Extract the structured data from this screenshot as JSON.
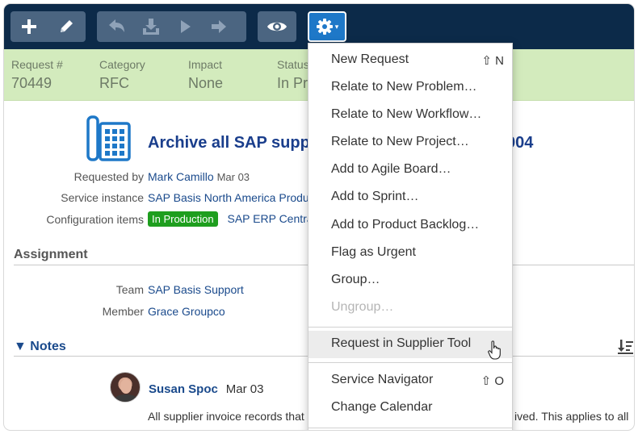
{
  "toolbar": {
    "buttons": [
      {
        "icon": "plus-icon",
        "label": "+"
      },
      {
        "icon": "pencil-icon"
      },
      {
        "icon": "undo-arrow-icon"
      },
      {
        "icon": "download-tray-icon"
      },
      {
        "icon": "play-icon"
      },
      {
        "icon": "right-arrow-icon"
      },
      {
        "icon": "eye-icon"
      },
      {
        "icon": "gear-icon"
      }
    ],
    "gear_caret": "▾"
  },
  "info": {
    "request_label": "Request #",
    "request_value": "70449",
    "category_label": "Category",
    "category_value": "RFC",
    "impact_label": "Impact",
    "impact_value": "None",
    "status_label": "Status",
    "status_value": "In Pr"
  },
  "request": {
    "title": "Archive all SAP supp",
    "title_end": "004",
    "requested_by_label": "Requested by",
    "requested_by": "Mark Camillo",
    "requested_date": "Mar 03",
    "service_instance_label": "Service instance",
    "service_instance": "SAP Basis North America Produc",
    "config_items_label": "Configuration items",
    "config_badge": "In Production",
    "config_item": "SAP ERP Central"
  },
  "assignment": {
    "heading": "Assignment",
    "team_label": "Team",
    "team": "SAP Basis Support",
    "member_label": "Member",
    "member": "Grace Groupco"
  },
  "notes": {
    "heading": "▼ Notes",
    "sort_icon": "sort-icon",
    "author": "Susan Spoc",
    "date": "Mar 03",
    "text_start": "All supplier invoice records that a",
    "text_end": "ived. This applies to all"
  },
  "menu": {
    "items": [
      {
        "label": "New Request",
        "shortcut": "⇧ N"
      },
      {
        "label": "Relate to New Problem…"
      },
      {
        "label": "Relate to New Workflow…"
      },
      {
        "label": "Relate to New Project…"
      },
      {
        "label": "Add to Agile Board…"
      },
      {
        "label": "Add to Sprint…"
      },
      {
        "label": "Add to Product Backlog…"
      },
      {
        "label": "Flag as Urgent"
      },
      {
        "label": "Group…"
      },
      {
        "label": "Ungroup…",
        "disabled": true
      },
      {
        "label": "Request in Supplier Tool",
        "hover": true
      },
      {
        "label": "Service Navigator",
        "shortcut": "⇧ O"
      },
      {
        "label": "Change Calendar"
      }
    ]
  },
  "colors": {
    "toolbar_bg": "#0c2a49",
    "button_bg": "#4b6581",
    "active_button": "#1e78c8",
    "info_bar": "#d3ebbd",
    "link": "#1a4a8c",
    "badge": "#1e9e1e"
  }
}
